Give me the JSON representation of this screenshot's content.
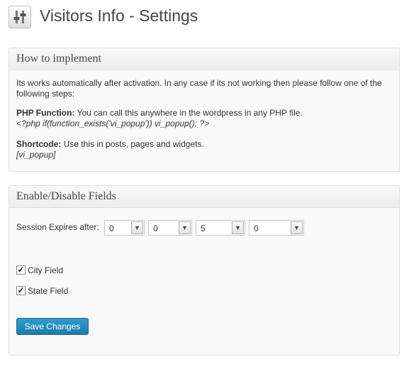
{
  "page": {
    "title": "Visitors Info - Settings",
    "icon": "settings-sliders-icon"
  },
  "implement": {
    "heading": "How to implement",
    "intro": "Its works automatically after activation. In any case if its not working then please follow one of the following steps:",
    "php_label": "PHP Function:",
    "php_text": " You can call this anywhere in the wordpress in any PHP file.",
    "php_code": "<?php if(function_exists('vi_popup')) vi_popup(); ?>",
    "shortcode_label": "Shortcode:",
    "shortcode_text": " Use this in posts, pages and widgets.",
    "shortcode_code": "[vi_popup]"
  },
  "fields": {
    "heading": "Enable/Disable Fields",
    "session_label": "Session Expires after:",
    "session_values": [
      "0",
      "0",
      "5",
      "0"
    ],
    "city_label": "City Field",
    "city_checked": true,
    "state_label": "State Field",
    "state_checked": true,
    "save_label": "Save Changes"
  },
  "colors": {
    "button": "#2385b8",
    "border": "#dfdfdf"
  }
}
